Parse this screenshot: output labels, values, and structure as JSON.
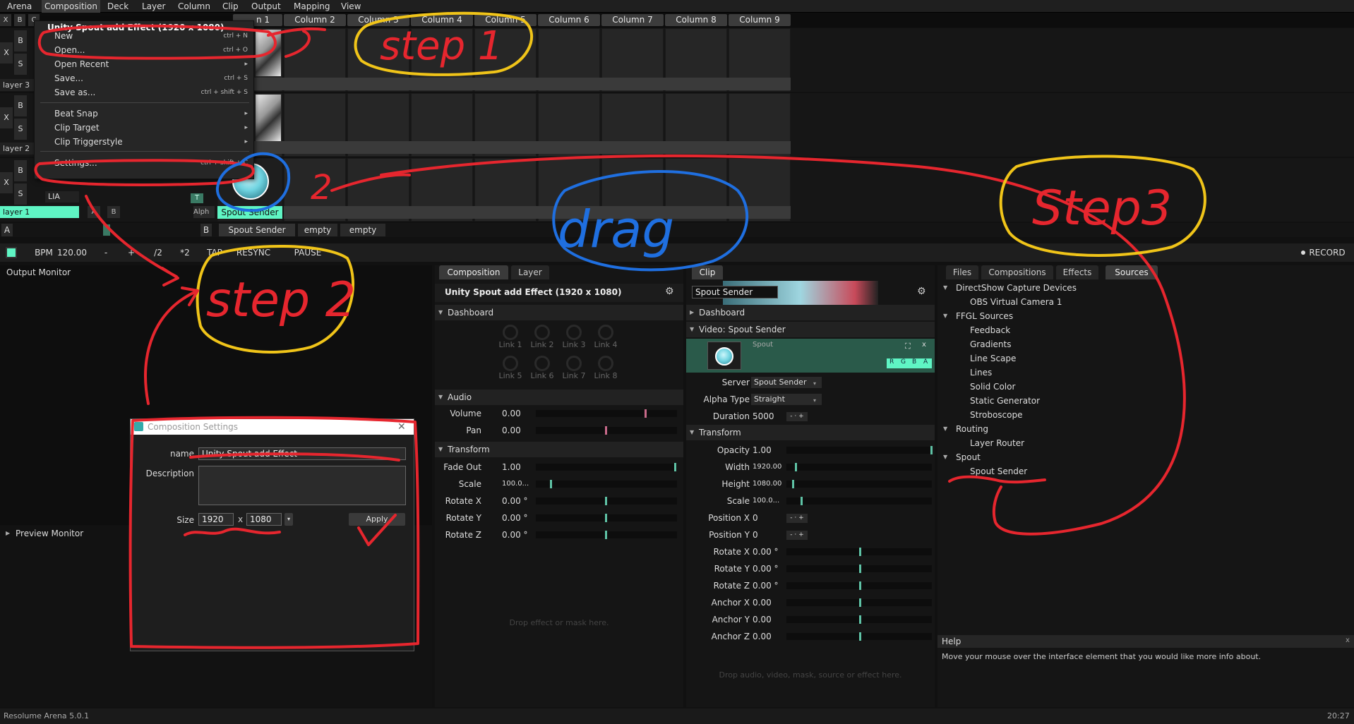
{
  "menubar": {
    "items": [
      "Arena",
      "Composition",
      "Deck",
      "Layer",
      "Column",
      "Clip",
      "Output",
      "Mapping",
      "View"
    ]
  },
  "columns": {
    "partial_first": "n 1",
    "names": [
      "Column 2",
      "Column 3",
      "Column 4",
      "Column 5",
      "Column 6",
      "Column 7",
      "Column 8",
      "Column 9"
    ]
  },
  "layer_controls": {
    "x": "X",
    "b": "B",
    "s": "S",
    "c": "C"
  },
  "layers": {
    "layer3": {
      "name": "layer 3"
    },
    "layer2": {
      "name": "layer 2"
    },
    "layer1": {
      "name": "layer 1",
      "mode": "LIA",
      "a": "A",
      "b": "B",
      "t": "T",
      "alpha": "Alph",
      "clip_name": "Spout Sender"
    }
  },
  "deck": {
    "a": "A",
    "b": "B",
    "tabs": [
      "Spout Sender",
      "empty",
      "empty"
    ]
  },
  "transport": {
    "bpm_label": "BPM",
    "bpm_value": "120.00",
    "minus": "-",
    "plus": "+",
    "half": "/2",
    "double": "*2",
    "tap": "TAP",
    "resync": "RESYNC",
    "pause": "PAUSE",
    "record": "RECORD"
  },
  "composition_menu": {
    "title": "Unity Spout add Effect (1920 x 1080)",
    "items": [
      {
        "label": "New",
        "shortcut": "ctrl + N"
      },
      {
        "label": "Open...",
        "shortcut": "ctrl + O"
      },
      {
        "label": "Open Recent",
        "shortcut": "▸"
      },
      {
        "label": "Save...",
        "shortcut": "ctrl + S"
      },
      {
        "label": "Save as...",
        "shortcut": "ctrl + shift + S"
      },
      {
        "label": "Beat Snap",
        "shortcut": "▸"
      },
      {
        "label": "Clip Target",
        "shortcut": "▸"
      },
      {
        "label": "Clip Triggerstyle",
        "shortcut": "▸"
      },
      {
        "label": "Settings...",
        "shortcut": "ctrl + shift + C"
      }
    ]
  },
  "output_monitor": {
    "title": "Output Monitor"
  },
  "preview_monitor": {
    "title": "Preview Monitor"
  },
  "comp_settings": {
    "title": "Composition Settings",
    "name_label": "name",
    "name_value": "Unity Spout add Effect",
    "description_label": "Description",
    "description_value": "",
    "size_label": "Size",
    "width": "1920",
    "x": "x",
    "height": "1080",
    "apply": "Apply"
  },
  "comp_panel": {
    "tabs": [
      "Composition",
      "Layer"
    ],
    "title": "Unity Spout add Effect (1920 x 1080)",
    "dashboard": "Dashboard",
    "links": [
      "Link 1",
      "Link 2",
      "Link 3",
      "Link 4",
      "Link 5",
      "Link 6",
      "Link 7",
      "Link 8"
    ],
    "audio": "Audio",
    "volume_label": "Volume",
    "volume_value": "0.00",
    "pan_label": "Pan",
    "pan_value": "0.00",
    "transform": "Transform",
    "fadeout_label": "Fade Out",
    "fadeout_value": "1.00",
    "scale_label": "Scale",
    "scale_value": "100.0...",
    "rotx_label": "Rotate X",
    "rotx_value": "0.00 °",
    "roty_label": "Rotate Y",
    "roty_value": "0.00 °",
    "rotz_label": "Rotate Z",
    "rotz_value": "0.00 °",
    "drop_hint": "Drop effect or mask here."
  },
  "clip_panel": {
    "tab": "Clip",
    "name": "Spout Sender",
    "dashboard": "Dashboard",
    "video_section": "Video: Spout Sender",
    "thumb_label": "Spout",
    "rgba": [
      "R",
      "G",
      "B",
      "A"
    ],
    "close": "x",
    "server_label": "Server",
    "server_value": "Spout Sender",
    "alpha_label": "Alpha Type",
    "alpha_value": "Straight",
    "duration_label": "Duration",
    "duration_value": "5000",
    "transform": "Transform",
    "rows": [
      {
        "label": "Opacity",
        "value": "1.00"
      },
      {
        "label": "Width",
        "value": "1920.00"
      },
      {
        "label": "Height",
        "value": "1080.00"
      },
      {
        "label": "Scale",
        "value": "100.0..."
      },
      {
        "label": "Position X",
        "value": "0"
      },
      {
        "label": "Position Y",
        "value": "0"
      },
      {
        "label": "Rotate X",
        "value": "0.00 °"
      },
      {
        "label": "Rotate Y",
        "value": "0.00 °"
      },
      {
        "label": "Rotate Z",
        "value": "0.00 °"
      },
      {
        "label": "Anchor X",
        "value": "0.00"
      },
      {
        "label": "Anchor Y",
        "value": "0.00"
      },
      {
        "label": "Anchor Z",
        "value": "0.00"
      }
    ],
    "stepper_minus": "-",
    "stepper_plus": "+",
    "drop_hint": "Drop audio, video, mask, source or effect here."
  },
  "sources_panel": {
    "tabs": [
      "Files",
      "Compositions",
      "Effects",
      "Sources"
    ],
    "tree": [
      {
        "label": "DirectShow Capture Devices",
        "level": 0
      },
      {
        "label": "OBS Virtual Camera 1",
        "level": 1
      },
      {
        "label": "FFGL Sources",
        "level": 0
      },
      {
        "label": "Feedback",
        "level": 1
      },
      {
        "label": "Gradients",
        "level": 1
      },
      {
        "label": "Line Scape",
        "level": 1
      },
      {
        "label": "Lines",
        "level": 1
      },
      {
        "label": "Solid Color",
        "level": 1
      },
      {
        "label": "Static Generator",
        "level": 1
      },
      {
        "label": "Stroboscope",
        "level": 1
      },
      {
        "label": "Routing",
        "level": 0
      },
      {
        "label": "Layer Router",
        "level": 1
      },
      {
        "label": "Spout",
        "level": 0
      },
      {
        "label": "Spout Sender",
        "level": 1
      }
    ]
  },
  "help": {
    "title": "Help",
    "text": "Move your mouse over the interface element that you would like more info about.",
    "close": "x"
  },
  "status": {
    "version": "Resolume Arena 5.0.1",
    "time": "20:27"
  },
  "annotations": {
    "step1": "step 1",
    "step2": "step 2",
    "step3": "Step3",
    "drag": "drag",
    "two": "2"
  },
  "colors": {
    "accent": "#5ff5c4",
    "clip_ball": "#6fd3e0",
    "ink_yellow": "#f0c419",
    "ink_red": "#e6262e",
    "ink_blue": "#1f6fe0"
  }
}
